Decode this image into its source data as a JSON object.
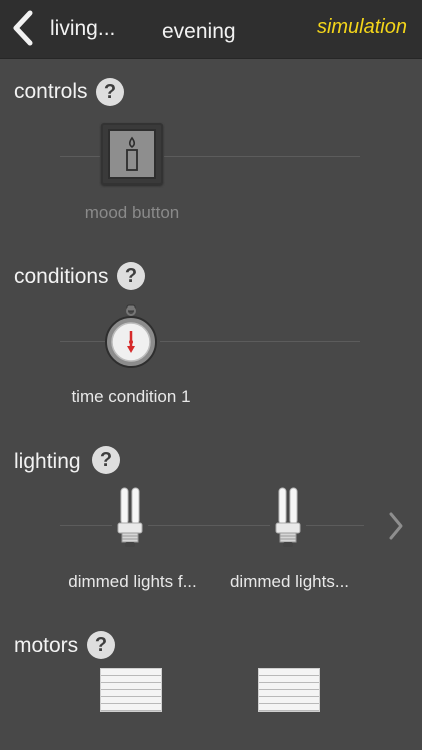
{
  "header": {
    "back_label": "living...",
    "title": "evening",
    "simulation_label": "simulation"
  },
  "sections": {
    "controls": {
      "title": "controls",
      "help": "?",
      "items": [
        {
          "label": "mood button",
          "icon": "candle-icon"
        }
      ]
    },
    "conditions": {
      "title": "conditions",
      "help": "?",
      "items": [
        {
          "label": "time condition 1",
          "icon": "stopwatch-icon"
        }
      ]
    },
    "lighting": {
      "title": "lighting",
      "help": "?",
      "items": [
        {
          "label": "dimmed lights f...",
          "icon": "bulb-icon"
        },
        {
          "label": "dimmed lights...",
          "icon": "bulb-icon"
        }
      ]
    },
    "motors": {
      "title": "motors",
      "help": "?",
      "items": [
        {
          "icon": "shutter-icon"
        },
        {
          "icon": "shutter-icon"
        }
      ]
    }
  },
  "colors": {
    "background": "#484848",
    "header": "#2f2f2f",
    "accent": "#f3d51a"
  }
}
